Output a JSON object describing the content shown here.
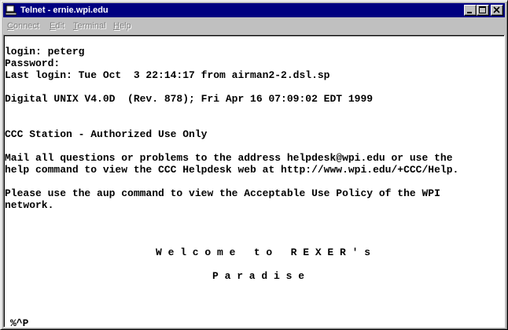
{
  "window": {
    "title": "Telnet - ernie.wpi.edu"
  },
  "menu": {
    "items": [
      {
        "first": "C",
        "rest": "onnect"
      },
      {
        "first": "E",
        "rest": "dit"
      },
      {
        "first": "T",
        "rest": "erminal"
      },
      {
        "first": "H",
        "rest": "elp"
      }
    ]
  },
  "terminal": {
    "lines": [
      "login: peterg",
      "Password:",
      "Last login: Tue Oct  3 22:14:17 from airman2-2.dsl.sp",
      "Digital UNIX V4.0D  (Rev. 878); Fri Apr 16 07:09:02 EDT 1999",
      "CCC Station - Authorized Use Only",
      "Mail all questions or problems to the address helpdesk@wpi.edu or use the",
      "help command to view the CCC Helpdesk web at http://www.wpi.edu/+CCC/Help.",
      "Please use the aup command to view the Acceptable Use Policy of the WPI",
      "network.",
      "W e l c o m e   t o   R E X E R ' s",
      "P a r a d i s e",
      "%^P"
    ]
  },
  "colors": {
    "titlebar": "#000080",
    "chrome": "#c0c0c0",
    "terminal_bg": "#ffffff",
    "terminal_fg": "#000000",
    "menu_disabled": "#808080"
  },
  "icons": [
    "telnet-app-icon",
    "minimize-icon",
    "maximize-icon",
    "close-icon"
  ]
}
